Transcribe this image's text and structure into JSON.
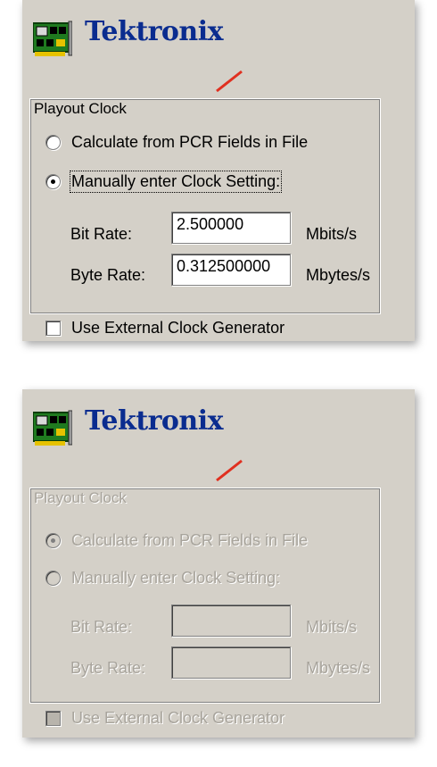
{
  "brand": {
    "name": "Tektronix",
    "text_color": "#0a2c8f",
    "accent_color": "#e03020",
    "icon": "network-card-icon"
  },
  "panels": [
    {
      "state": "enabled",
      "group_title": "Playout Clock",
      "option_pcr": {
        "label": "Calculate from PCR Fields in File",
        "selected": false
      },
      "option_manual": {
        "label": "Manually enter Clock Setting:",
        "selected": true
      },
      "bit_rate": {
        "label": "Bit Rate:",
        "value": "2.500000",
        "unit": "Mbits/s"
      },
      "byte_rate": {
        "label": "Byte Rate:",
        "value": "0.312500000",
        "unit": "Mbytes/s"
      },
      "external_clock": {
        "label": "Use External Clock Generator",
        "checked": false
      }
    },
    {
      "state": "disabled",
      "group_title": "Playout Clock",
      "option_pcr": {
        "label": "Calculate from PCR Fields in File",
        "selected": true
      },
      "option_manual": {
        "label": "Manually enter Clock Setting:",
        "selected": false
      },
      "bit_rate": {
        "label": "Bit Rate:",
        "value": "",
        "unit": "Mbits/s"
      },
      "byte_rate": {
        "label": "Byte Rate:",
        "value": "",
        "unit": "Mbytes/s"
      },
      "external_clock": {
        "label": "Use External Clock Generator",
        "checked": false
      }
    }
  ],
  "colors": {
    "dialog_bg": "#d4d0c8",
    "disabled_text": "#a8a49c"
  }
}
